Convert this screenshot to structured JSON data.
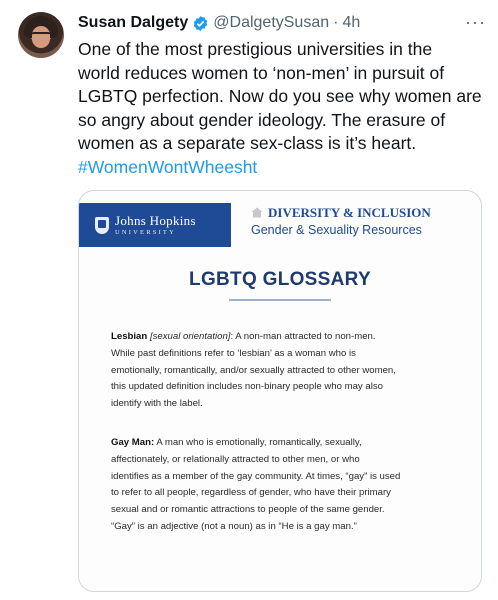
{
  "tweet": {
    "author": "Susan Dalgety",
    "handle": "@DalgetySusan",
    "separator": "·",
    "time": "4h",
    "more": "···",
    "text_lines": [
      "One of the most prestigious universities in the",
      "world reduces women to ‘non-men’ in pursuit of",
      "LGBTQ perfection. Now do you see  why women are",
      "so angry about gender ideology. The erasure of",
      "women as a separate sex-class is it’s heart."
    ],
    "hashtag": "#WomenWontWheesht",
    "colors": {
      "link": "#1d9bf0",
      "verified": "#1d9bf0",
      "muted": "#536471"
    }
  },
  "card": {
    "logo": {
      "name": "Johns Hopkins",
      "sub": "UNIVERSITY"
    },
    "dept": {
      "title": "DIVERSITY & INCLUSION",
      "sub": "Gender & Sexuality Resources"
    },
    "glossary_title": "LGBTQ GLOSSARY",
    "entries": [
      {
        "term": "Lesbian",
        "qualifier": "[sexual orientation]",
        "first": ": A non-man attracted to non-men.",
        "lines": [
          "While past definitions refer to ‘lesbian’ as a woman who is",
          "emotionally, romantically, and/or sexually attracted to other women,",
          "this updated definition includes non-binary people who may also",
          "identify with the label."
        ]
      },
      {
        "term": "Gay Man:",
        "first": " A man who is emotionally, romantically, sexually,",
        "lines": [
          "affectionately, or relationally attracted to other men, or who",
          "identifies as a member of the gay community. At times, “gay” is used",
          "to refer to all people, regardless of gender, who have their primary",
          "sexual and or romantic attractions to people of the same gender.",
          "“Gay” is an adjective (not a noun) as in “He is a gay man.”"
        ]
      }
    ],
    "colors": {
      "brand": "#1f4b96",
      "title": "#1f3a6d"
    }
  }
}
